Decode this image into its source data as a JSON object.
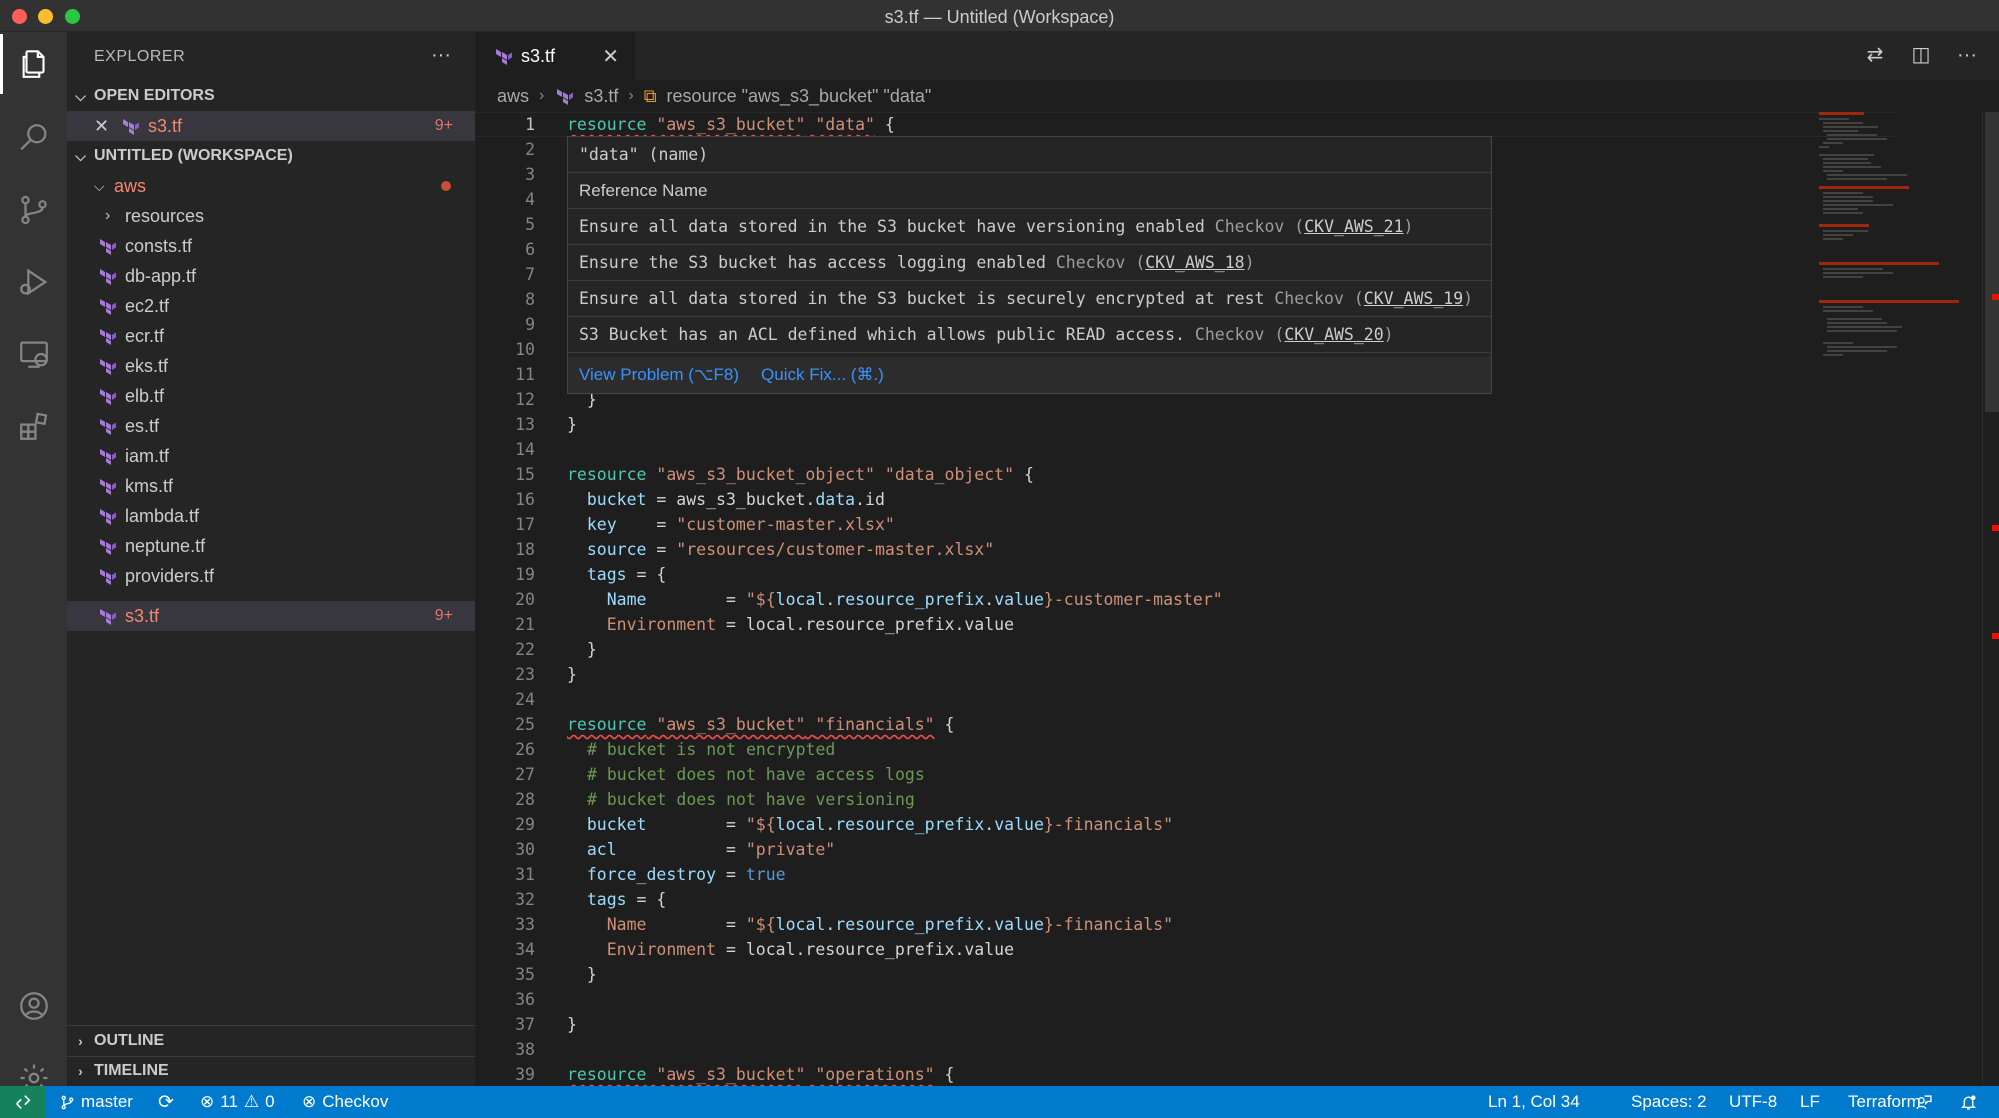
{
  "window": {
    "title": "s3.tf — Untitled (Workspace)"
  },
  "sidebar": {
    "title": "EXPLORER",
    "more": "···",
    "open_editors": {
      "heading": "OPEN EDITORS",
      "items": [
        {
          "name": "s3.tf",
          "badge": "9+"
        }
      ]
    },
    "workspace": {
      "heading": "UNTITLED (WORKSPACE)",
      "folder": "aws",
      "files": [
        {
          "name": "resources",
          "type": "folder"
        },
        {
          "name": "consts.tf"
        },
        {
          "name": "db-app.tf"
        },
        {
          "name": "ec2.tf"
        },
        {
          "name": "ecr.tf"
        },
        {
          "name": "eks.tf"
        },
        {
          "name": "elb.tf"
        },
        {
          "name": "es.tf"
        },
        {
          "name": "iam.tf"
        },
        {
          "name": "kms.tf"
        },
        {
          "name": "lambda.tf"
        },
        {
          "name": "neptune.tf"
        },
        {
          "name": "providers.tf"
        },
        {
          "name": "s3.tf",
          "badge": "9+",
          "selected": true
        }
      ]
    },
    "outline": "OUTLINE",
    "timeline": "TIMELINE"
  },
  "tab": {
    "label": "s3.tf",
    "close": "✕"
  },
  "breadcrumb": {
    "folder": "aws",
    "file": "s3.tf",
    "symbol": "resource \"aws_s3_bucket\" \"data\""
  },
  "hover": {
    "title": "\"data\" (name)",
    "subtitle": "Reference Name",
    "problems": [
      {
        "text": "Ensure all data stored in the S3 bucket have versioning enabled",
        "source": "Checkov",
        "code": "CKV_AWS_21"
      },
      {
        "text": "Ensure the S3 bucket has access logging enabled",
        "source": "Checkov",
        "code": "CKV_AWS_18"
      },
      {
        "text": "Ensure all data stored in the S3 bucket is securely encrypted at rest",
        "source": "Checkov",
        "code": "CKV_AWS_19"
      },
      {
        "text": "S3 Bucket has an ACL defined which allows public READ access.",
        "source": "Checkov",
        "code": "CKV_AWS_20"
      }
    ],
    "view_problem": "View Problem (⌥F8)",
    "quick_fix": "Quick Fix... (⌘.)"
  },
  "editor": {
    "line_numbers": [
      "1",
      "2",
      "3",
      "4",
      "5",
      "6",
      "7",
      "8",
      "9",
      "10",
      "11",
      "12",
      "13",
      "14",
      "15",
      "16",
      "17",
      "18",
      "19",
      "20",
      "21",
      "22",
      "23",
      "24",
      "25",
      "26",
      "27",
      "28",
      "29",
      "30",
      "31",
      "32",
      "33",
      "34",
      "35",
      "36",
      "37",
      "38",
      "39"
    ],
    "code": {
      "l1_kw": "resource",
      "l1_s1": "\"aws_s3_bucket\"",
      "l1_s2": "\"data\"",
      "l1_brace": " {",
      "l12": "  }",
      "l13": "}",
      "l15_kw": "resource",
      "l15_s1": "\"aws_s3_bucket_object\"",
      "l15_s2": "\"data_object\"",
      "l15_brace": " {",
      "l16_attr": "bucket",
      "l16_eq": " = aws_s3_bucket.",
      "l16_v": "data",
      "l16_end": ".id",
      "l17_attr": "key",
      "l17_eq": "    = ",
      "l17_v": "\"customer-master.xlsx\"",
      "l18_attr": "source",
      "l18_eq": " = ",
      "l18_v": "\"resources/customer-master.xlsx\"",
      "l19_attr": "tags",
      "l19_eq": " = {",
      "l20_attr": "Name",
      "l20_eq": "        = ",
      "l20_a": "\"${",
      "l20_b": "local",
      "l20_c": ".",
      "l20_d": "resource_prefix",
      "l20_e": ".",
      "l20_f": "value",
      "l20_g": "}-customer-master\"",
      "l21_attr": "Environment",
      "l21_eq": " = local.resource_prefix.value",
      "l22": "  }",
      "l23": "}",
      "l25_kw": "resource",
      "l25_s1": "\"aws_s3_bucket\"",
      "l25_s2": "\"financials\"",
      "l25_brace": " {",
      "l26": "# bucket is not encrypted",
      "l27": "# bucket does not have access logs",
      "l28": "# bucket does not have versioning",
      "l29_attr": "bucket",
      "l29_eq": "        = ",
      "l29_a": "\"${",
      "l29_b": "local",
      "l29_c": ".",
      "l29_d": "resource_prefix",
      "l29_e": ".",
      "l29_f": "value",
      "l29_g": "}-financials\"",
      "l30_attr": "acl",
      "l30_eq": "           = ",
      "l30_v": "\"private\"",
      "l31_attr": "force_destroy",
      "l31_eq": " = ",
      "l31_v": "true",
      "l32_attr": "tags",
      "l32_eq": " = {",
      "l33_attr": "Name",
      "l33_eq": "        = ",
      "l33_a": "\"${",
      "l33_b": "local",
      "l33_c": ".",
      "l33_d": "resource_prefix",
      "l33_e": ".",
      "l33_f": "value",
      "l33_g": "}-financials\"",
      "l34_attr": "Environment",
      "l34_eq": " = local.resource_prefix.value",
      "l35": "  }",
      "l37": "}",
      "l39_kw": "resource",
      "l39_s1": "\"aws_s3_bucket\"",
      "l39_s2": "\"operations\"",
      "l39_brace": " {"
    }
  },
  "statusbar": {
    "branch": "master",
    "errors": "11",
    "warnings": "0",
    "checkov": "Checkov",
    "position": "Ln 1, Col 34",
    "spaces": "Spaces: 2",
    "encoding": "UTF-8",
    "eol": "LF",
    "language": "Terraform"
  },
  "colors": {
    "accent": "#007acc",
    "error": "#f14c4c",
    "terraform": "#7b42bc"
  }
}
